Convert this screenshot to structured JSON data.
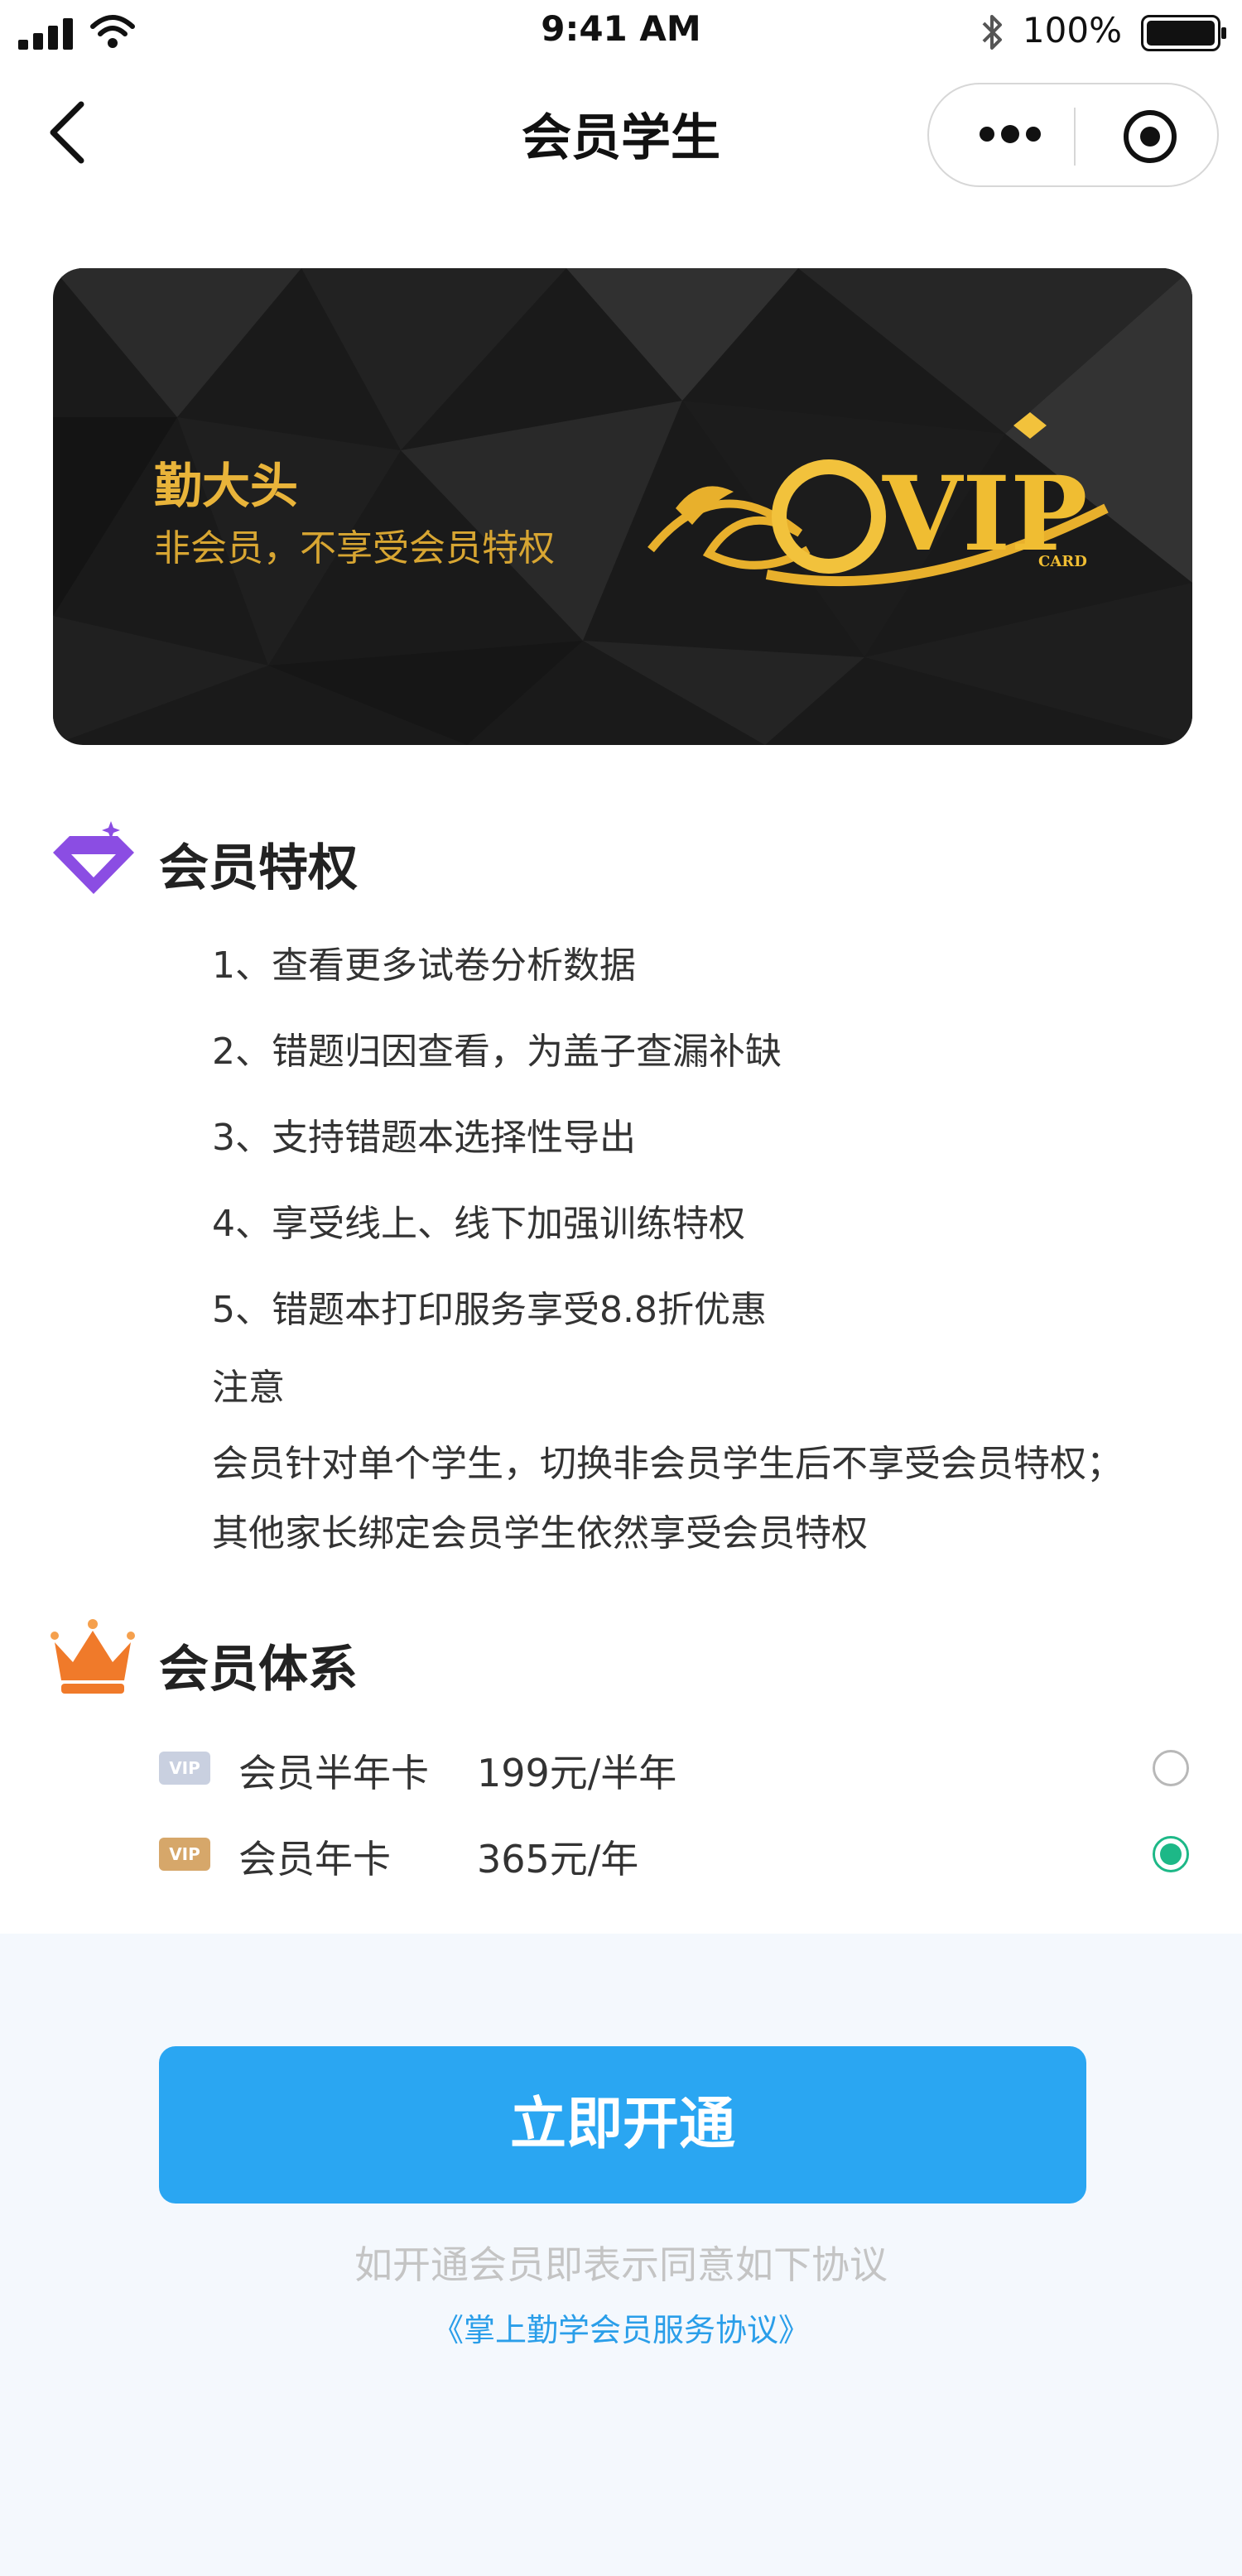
{
  "status_bar": {
    "time": "9:41 AM",
    "battery_percent": "100%"
  },
  "nav": {
    "title": "会员学生"
  },
  "card": {
    "name": "勤大头",
    "subtitle": "非会员，不享受会员特权",
    "logo_text": "VIP",
    "logo_sub": "CARD"
  },
  "privileges": {
    "title": "会员特权",
    "items": [
      "1、查看更多试卷分析数据",
      "2、错题归因查看，为盖子查漏补缺",
      "3、支持错题本选择性导出",
      "4、享受线上、线下加强训练特权",
      "5、错题本打印服务享受8.8折优惠",
      "注意",
      "会员针对单个学生，切换非会员学生后不享受会员特权；",
      "其他家长绑定会员学生依然享受会员特权"
    ]
  },
  "membership": {
    "title": "会员体系",
    "plans": [
      {
        "badge": "VIP",
        "label": "会员半年卡",
        "price": "199元/半年",
        "selected": false,
        "badge_color": "#c9d0e0"
      },
      {
        "badge": "VIP",
        "label": "会员年卡",
        "price": "365元/年",
        "selected": true,
        "badge_color": "#d6a76a"
      }
    ]
  },
  "cta": {
    "button_label": "立即开通",
    "agreement_text": "如开通会员即表示同意如下协议",
    "agreement_link": "《掌上勤学会员服务协议》"
  },
  "colors": {
    "accent": "#2aa6f2",
    "gold": "#e9b43a",
    "selected": "#1db887",
    "privilege_icon": "#8b4de3",
    "crown": "#f07a2a"
  },
  "icons": [
    "signal-icon",
    "wifi-icon",
    "bluetooth-icon",
    "battery-icon",
    "back-icon",
    "more-icon",
    "target-icon",
    "diamond-icon",
    "crown-icon"
  ]
}
